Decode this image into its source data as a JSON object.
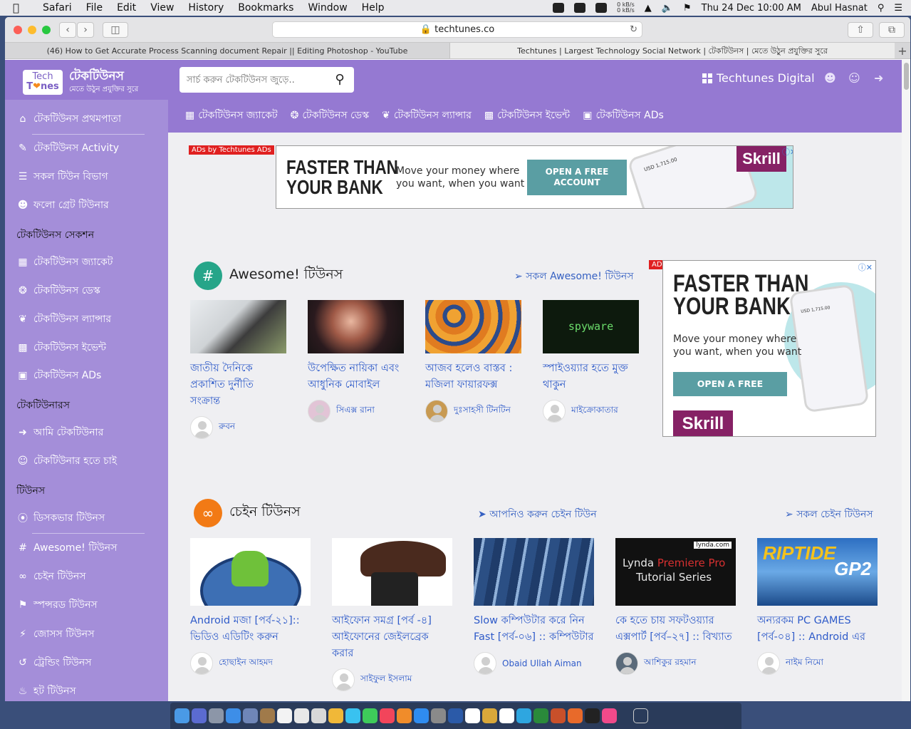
{
  "menubar": {
    "app": "Safari",
    "items": [
      "File",
      "Edit",
      "View",
      "History",
      "Bookmarks",
      "Window",
      "Help"
    ],
    "net_up": "0 kB/s",
    "net_down": "0 kB/s",
    "datetime": "Thu 24 Dec  10:00 AM",
    "user": "Abul Hasnat"
  },
  "browser": {
    "url": "techtunes.co",
    "tabs": [
      "(46) How to Get Accurate Process Scanning document Repair || Editing Photoshop - YouTube",
      "Techtunes | Largest Technology Social Network | টেকটিউনস | মেতে উঠুন প্রযুক্তির সুরে"
    ]
  },
  "site": {
    "logo_line1": "Tech",
    "logo_line2a": "T",
    "logo_line2b": "nes",
    "name": "টেকটিউনস",
    "tagline": "মেতে উঠুন প্রযুক্তির সুরে"
  },
  "search": {
    "placeholder": "সার্চ করুন টেকটিউনস জুড়ে.."
  },
  "header": {
    "digital": "Techtunes Digital",
    "nav": [
      "টেকটিউনস জ্যাকেট",
      "টেকটিউনস ডেস্ক",
      "টেকটিউনস ল্যান্সার",
      "টেকটিউনস ইভেন্ট",
      "টেকটিউনস ADs"
    ]
  },
  "sidebar": {
    "items": [
      "টেকটিউনস প্রথমপাতা",
      "টেকটিউনস Activity",
      "সকল টিউন বিভাগ",
      "ফলো গ্রেট টিউনার",
      "টেকটিউনস জ্যাকেট",
      "টেকটিউনস ডেস্ক",
      "টেকটিউনস ল্যান্সার",
      "টেকটিউনস ইভেন্ট",
      "টেকটিউনস ADs",
      "আমি টেকটিউনার",
      "টেকটিউনার হতে চাই",
      "ডিসকভার টিউনস",
      "Awesome! টিউনস",
      "চেইন টিউনস",
      "স্পন্সরড টিউনস",
      "জোসস টিউনস",
      "ট্রেন্ডিং টিউনস",
      "হট টিউনস"
    ],
    "sections": [
      "টেকটিউনস সেকশন",
      "টেকটিউনারস",
      "টিউনস"
    ]
  },
  "ad": {
    "label": "ADs by Techtunes ADs",
    "slogan_line1": "FASTER THAN",
    "slogan_line2": "YOUR BANK",
    "copy_line1": "Move your money where",
    "copy_line2": "you want, when you want",
    "cta_top_line1": "OPEN A FREE",
    "cta_top_line2": "ACCOUNT",
    "cta_side": "OPEN A FREE ACCOUNT",
    "brand": "Skrill",
    "phone_amount": "USD 1,715.00"
  },
  "awesome": {
    "title": "Awesome! টিউনস",
    "link": "সকল Awesome! টিউনস",
    "cards": [
      {
        "title_line1": "জাতীয় দৈনিকে",
        "title_line2": "প্রকাশিত দুর্নীতি সংক্রান্ত",
        "author": "রুবন"
      },
      {
        "title_line1": "উপেক্ষিত নায়িকা এবং",
        "title_line2": "আধুনিক মোবাইল",
        "author": "সিএক্স রানা"
      },
      {
        "title_line1": "আজব হলেও বাস্তব :",
        "title_line2": "মজিলা ফায়ারফক্স",
        "author": "দুঃসাহসী টিনটিন"
      },
      {
        "title_line1": "স্পাইওয়্যার হতে মুক্ত",
        "title_line2": "থাকুন",
        "author": "মাইক্রোকাতার",
        "thumb_text": "spyware"
      }
    ]
  },
  "chain": {
    "title": "চেইন টিউনস",
    "link_join": "আপনিও করুন চেইন টিউন",
    "link_all": "সকল চেইন টিউনস",
    "cards": [
      {
        "title_line1": "Android মজা [পর্ব-২১]::",
        "title_line2": "ভিডিও এডিটিং করুন",
        "author": "হোছাইন আহমদ"
      },
      {
        "title_line1": "আইফোন সমগ্র [পর্ব -৪]",
        "title_line2": "আইফোনের জেইলব্রেক করার",
        "author": "সাইফুল ইসলাম"
      },
      {
        "title_line1": "Slow কম্পিউটার করে নিন",
        "title_line2": "Fast [পর্ব-০৬] :: কম্পিউটার",
        "author": "Obaid Ullah Aiman"
      },
      {
        "title_line1": "কে হতে চায় সফটওয়্যার",
        "title_line2": "এক্সপার্ট [পর্ব–২৭] :: বিখ্যাত",
        "author": "আশিকুর রহমান",
        "thumb_brand": "lynda.com",
        "thumb_line1a": "Lynda ",
        "thumb_line1b": "Premiere Pro",
        "thumb_line2": "Tutorial Series"
      },
      {
        "title_line1": "অন্যরকম PC GAMES",
        "title_line2": "[পর্ব-০৪] :: Android এর",
        "author": "নাইম নিমো",
        "thumb_text": "RIPTIDE",
        "thumb_sub": "GP2"
      }
    ]
  },
  "colors": {
    "brand_purple": "#9579d2",
    "sidebar_purple": "#a48ed9",
    "link_blue": "#2f5bc9",
    "awesome_badge": "#26a589",
    "chain_badge": "#f27a15",
    "ad_red": "#e02020",
    "skrill": "#862165"
  }
}
